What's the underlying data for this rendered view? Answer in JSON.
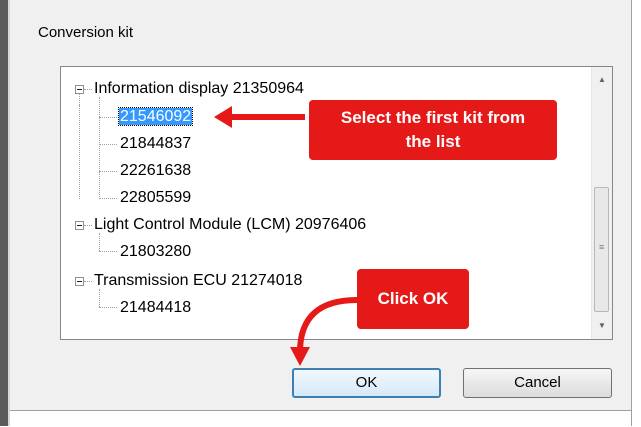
{
  "dialog": {
    "group_label": "Conversion kit"
  },
  "tree": {
    "items": [
      {
        "label": "Information display 21350964",
        "level": 0,
        "expanded": true
      },
      {
        "label": "21546092",
        "level": 1,
        "selected": true
      },
      {
        "label": "21844837",
        "level": 1
      },
      {
        "label": "22261638",
        "level": 1
      },
      {
        "label": "22805599",
        "level": 1
      },
      {
        "label": "Light Control Module (LCM) 20976406",
        "level": 0,
        "expanded": true
      },
      {
        "label": "21803280",
        "level": 1
      },
      {
        "label": "Transmission ECU 21274018",
        "level": 0,
        "expanded": true
      },
      {
        "label": "21484418",
        "level": 1
      }
    ]
  },
  "buttons": {
    "ok_label": "OK",
    "cancel_label": "Cancel"
  },
  "annotations": {
    "callout1_line1": "Select the first kit from",
    "callout1_line2": "the list",
    "callout2": "Click OK"
  },
  "colors": {
    "callout": "#e61919",
    "selection": "#3399ff"
  }
}
